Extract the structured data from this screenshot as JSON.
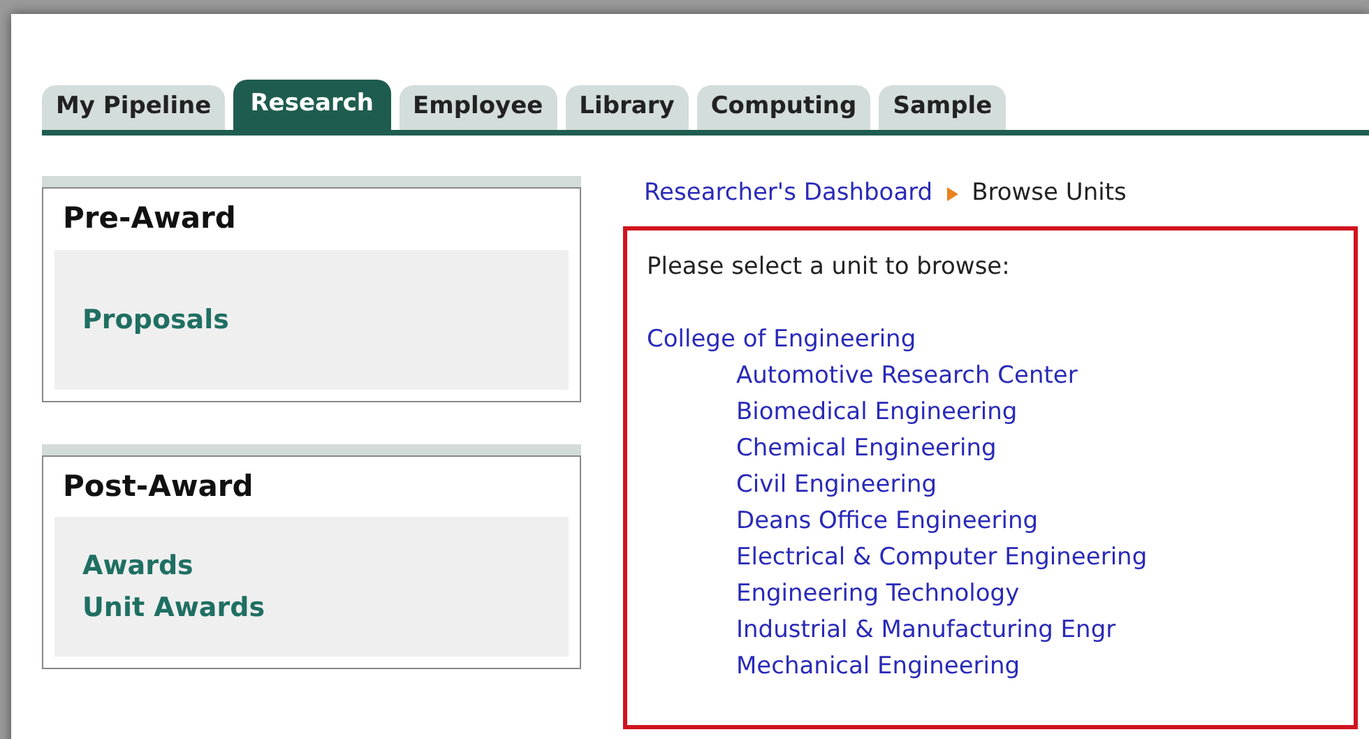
{
  "tabs": [
    {
      "label": "My Pipeline",
      "selected": false
    },
    {
      "label": "Research",
      "selected": true
    },
    {
      "label": "Employee",
      "selected": false
    },
    {
      "label": "Library",
      "selected": false
    },
    {
      "label": "Computing",
      "selected": false
    },
    {
      "label": "Sample",
      "selected": false
    }
  ],
  "sidebar": {
    "panels": [
      {
        "title": "Pre-Award",
        "links": [
          "Proposals"
        ]
      },
      {
        "title": "Post-Award",
        "links": [
          "Awards",
          "Unit Awards"
        ]
      }
    ]
  },
  "breadcrumb": [
    {
      "label": "Researcher's Dashboard",
      "kind": "link"
    },
    {
      "label": "Browse Units",
      "kind": "current"
    }
  ],
  "prompt": "Please select a unit to browse:",
  "units": [
    {
      "label": "College of Engineering",
      "children": [
        {
          "label": "Automotive Research Center"
        },
        {
          "label": "Biomedical Engineering"
        },
        {
          "label": "Chemical Engineering"
        },
        {
          "label": "Civil Engineering"
        },
        {
          "label": "Deans Office Engineering"
        },
        {
          "label": "Electrical & Computer Engineering"
        },
        {
          "label": "Engineering Technology"
        },
        {
          "label": "Industrial & Manufacturing Engr"
        },
        {
          "label": "Mechanical Engineering"
        }
      ]
    }
  ]
}
